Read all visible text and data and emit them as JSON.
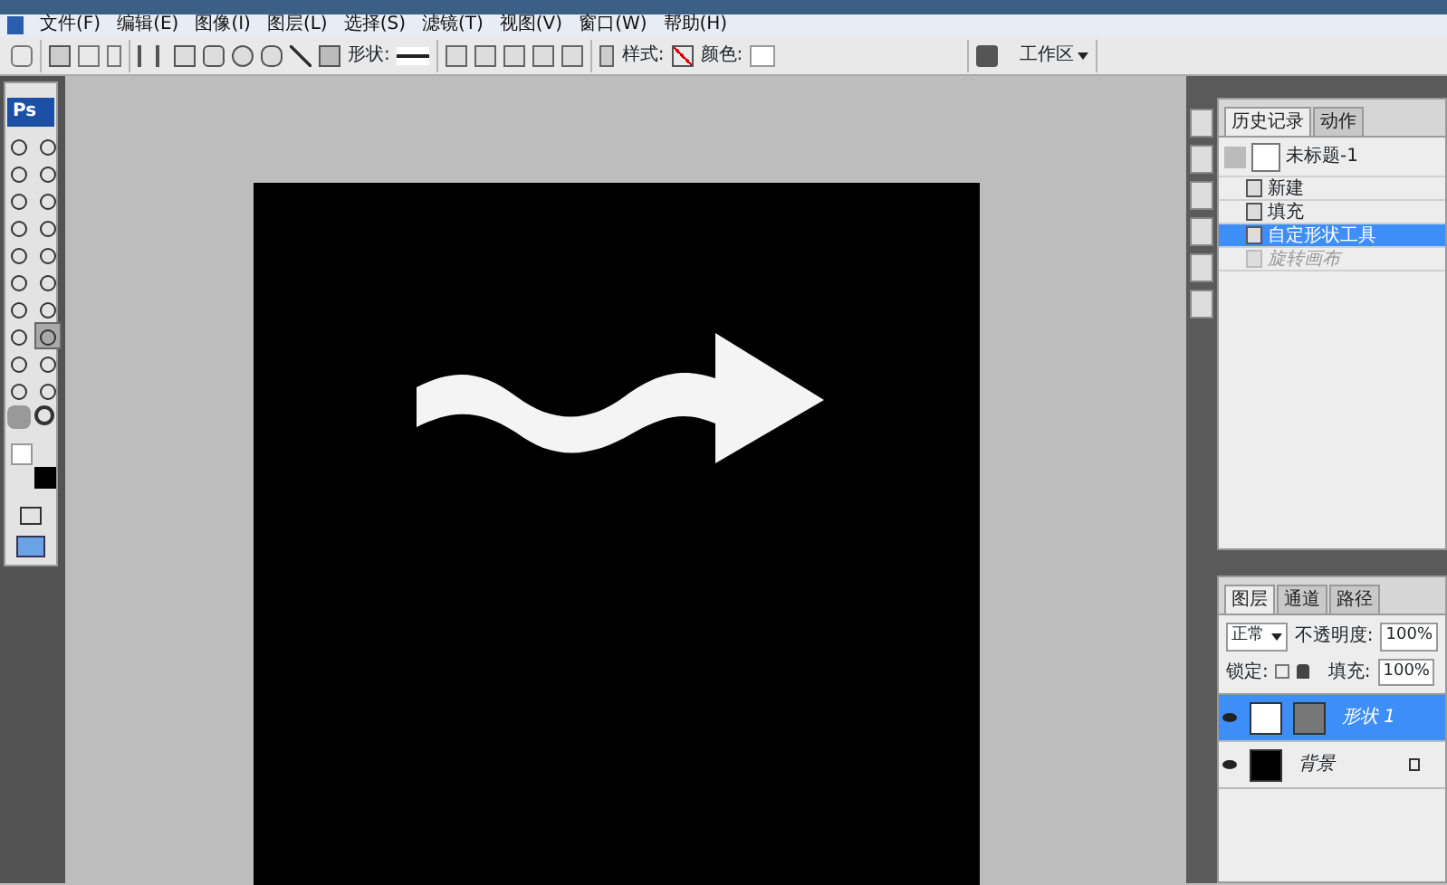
{
  "logo": "Ps",
  "menu": [
    "文件(F)",
    "编辑(E)",
    "图像(I)",
    "图层(L)",
    "选择(S)",
    "滤镜(T)",
    "视图(V)",
    "窗口(W)",
    "帮助(H)"
  ],
  "options_bar": {
    "shape_label": "形状:",
    "style_label": "样式:",
    "color_label": "颜色:",
    "workspace": "工作区"
  },
  "tools": [
    {
      "selected": false
    },
    {
      "selected": false
    },
    {
      "selected": false
    },
    {
      "selected": false
    },
    {
      "selected": false
    },
    {
      "selected": false
    },
    {
      "selected": false
    },
    {
      "selected": false
    },
    {
      "selected": false
    },
    {
      "selected": false
    },
    {
      "selected": false
    },
    {
      "selected": false
    },
    {
      "selected": false
    },
    {
      "selected": false
    },
    {
      "selected": false
    },
    {
      "selected": true
    },
    {
      "selected": false
    },
    {
      "selected": false
    },
    {
      "selected": false
    },
    {
      "selected": false
    }
  ],
  "history": {
    "tabs": [
      {
        "label": "历史记录",
        "selected": true
      },
      {
        "label": "动作",
        "selected": false
      }
    ],
    "snapshot": "未标题-1",
    "items": [
      {
        "label": "新建",
        "selected": false,
        "disabled": false
      },
      {
        "label": "填充",
        "selected": false,
        "disabled": false
      },
      {
        "label": "自定形状工具",
        "selected": true,
        "disabled": false
      },
      {
        "label": "旋转画布",
        "selected": false,
        "disabled": true
      }
    ]
  },
  "layers": {
    "tabs": [
      {
        "label": "图层",
        "selected": true
      },
      {
        "label": "通道",
        "selected": false
      },
      {
        "label": "路径",
        "selected": false
      }
    ],
    "mode": "正常",
    "opacity_label": "不透明度:",
    "opacity": "100%",
    "lock_label": "锁定:",
    "fill_label": "填充:",
    "fill": "100%",
    "items": [
      {
        "name": "形状 1",
        "kind": "shape",
        "selected": true,
        "visible": true,
        "locked": false
      },
      {
        "name": "背景",
        "kind": "background",
        "selected": false,
        "visible": true,
        "locked": true
      }
    ]
  }
}
